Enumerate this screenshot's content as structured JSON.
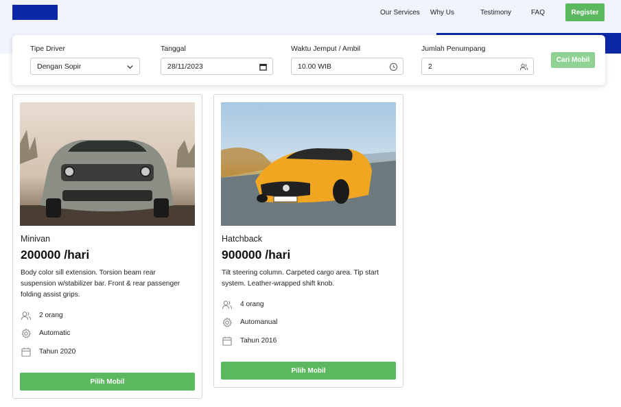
{
  "header": {
    "nav": [
      "Our Services",
      "Why Us",
      "Testimony",
      "FAQ"
    ],
    "register_label": "Register"
  },
  "search": {
    "driver_label": "Tipe Driver",
    "driver_value": "Dengan Sopir",
    "date_label": "Tanggal",
    "date_value": "28/11/2023",
    "time_label": "Waktu Jemput / Ambil",
    "time_value": "10.00 WIB",
    "passenger_label": "Jumlah Penumpang",
    "passenger_value": "2",
    "submit_label": "Cari Mobil"
  },
  "cars": [
    {
      "type": "Minivan",
      "price": "200000 /hari",
      "description": "Body color sill extension. Torsion beam rear suspension w/stabilizer bar. Front & rear passenger folding assist grips.",
      "capacity": "2 orang",
      "transmission": "Automatic",
      "year": "Tahun 2020",
      "button_label": "Pilih Mobil",
      "photo_colors": {
        "sky": "#d9cfc4",
        "body": "#8c8f86",
        "accent": "#3a3d3a"
      }
    },
    {
      "type": "Hatchback",
      "price": "900000 /hari",
      "description": "Tilt steering column. Carpeted cargo area. Tip start system. Leather-wrapped shift knob.",
      "capacity": "4 orang",
      "transmission": "Automanual",
      "year": "Tahun 2016",
      "button_label": "Pilih Mobil",
      "photo_colors": {
        "sky": "#a8c8e2",
        "body": "#f0a621",
        "accent": "#5a6a72"
      }
    }
  ],
  "colors": {
    "brand_blue": "#0d28a6",
    "green": "#5cb85f",
    "green_disabled": "#8fd293",
    "header_bg": "#f1f3fe"
  }
}
